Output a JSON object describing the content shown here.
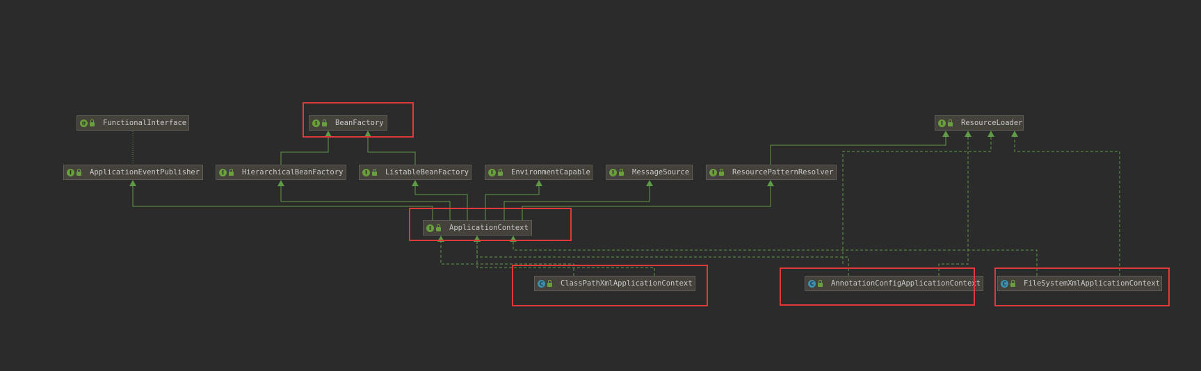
{
  "nodes": {
    "functional_interface": {
      "label": "FunctionalInterface",
      "kind": "anno"
    },
    "bean_factory": {
      "label": "BeanFactory",
      "kind": "iface"
    },
    "resource_loader": {
      "label": "ResourceLoader",
      "kind": "iface"
    },
    "application_event_publisher": {
      "label": "ApplicationEventPublisher",
      "kind": "iface"
    },
    "hierarchical_bean_factory": {
      "label": "HierarchicalBeanFactory",
      "kind": "iface"
    },
    "listable_bean_factory": {
      "label": "ListableBeanFactory",
      "kind": "iface"
    },
    "environment_capable": {
      "label": "EnvironmentCapable",
      "kind": "iface"
    },
    "message_source": {
      "label": "MessageSource",
      "kind": "iface"
    },
    "resource_pattern_resolver": {
      "label": "ResourcePatternResolver",
      "kind": "iface"
    },
    "application_context": {
      "label": "ApplicationContext",
      "kind": "iface"
    },
    "class_path_xml_application_context": {
      "label": "ClassPathXmlApplicationContext",
      "kind": "cls"
    },
    "annotation_config_application_context": {
      "label": "AnnotationConfigApplicationContext",
      "kind": "cls"
    },
    "file_system_xml_application_context": {
      "label": "FileSystemXmlApplicationContext",
      "kind": "cls"
    }
  },
  "kind_glyphs": {
    "iface": "I",
    "anno": "@",
    "cls": "C"
  },
  "colors": {
    "background": "#2b2b2b",
    "edge": "#5f9a46",
    "node_fill": "#45423c",
    "highlight": "#e0393b"
  }
}
